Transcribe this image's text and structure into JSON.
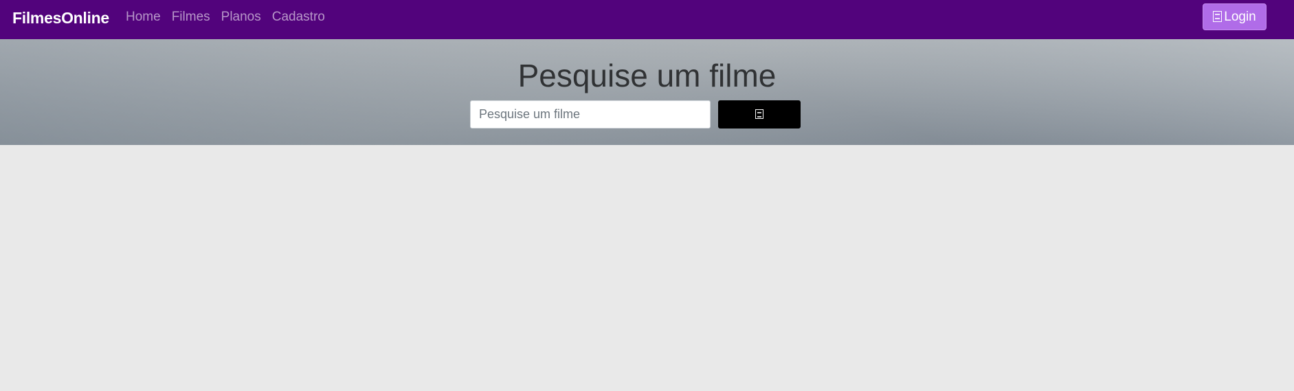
{
  "navbar": {
    "brand": "FilmesOnline",
    "links": [
      "Home",
      "Filmes",
      "Planos",
      "Cadastro"
    ],
    "login_label": "Login",
    "login_icon": "login-icon",
    "colors": {
      "background": "#52037c",
      "login_button": "#b06ce8"
    }
  },
  "hero": {
    "title": "Pesquise um filme",
    "search_placeholder": "Pesquise um filme",
    "search_value": "",
    "search_icon": "search-icon",
    "colors": {
      "search_button": "#000000"
    }
  },
  "content": {
    "background": "#e9e9e9"
  }
}
